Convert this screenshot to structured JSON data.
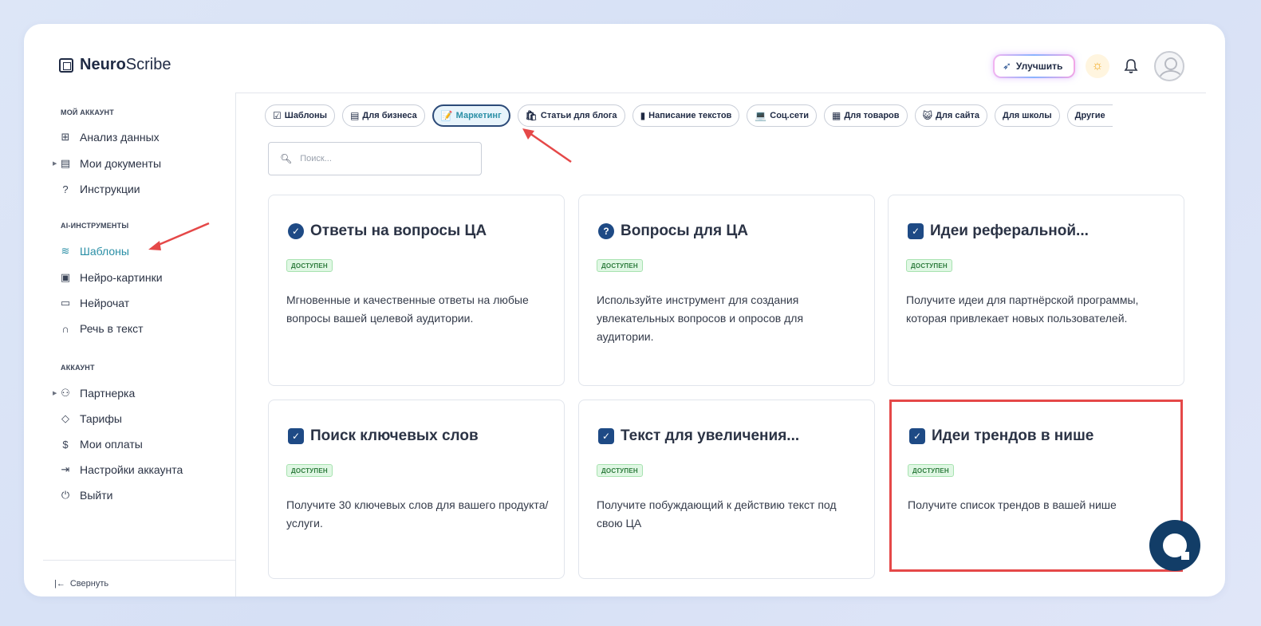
{
  "header": {
    "logo_bold": "Neuro",
    "logo_light": "Scribe",
    "upgrade_label": "Улучшить"
  },
  "sidebar": {
    "sections": [
      {
        "title": "МОЙ АККАУНТ"
      },
      {
        "title": "AI-ИНСТРУМЕНТЫ"
      },
      {
        "title": "АККАУНТ"
      }
    ],
    "items": [
      {
        "label": "Анализ данных",
        "icon": "grid-icon"
      },
      {
        "label": "Мои документы",
        "icon": "document-icon"
      },
      {
        "label": "Инструкции",
        "icon": "help-circle-icon"
      },
      {
        "label": "Шаблоны",
        "icon": "layers-icon"
      },
      {
        "label": "Нейро-картинки",
        "icon": "image-icon"
      },
      {
        "label": "Нейрочат",
        "icon": "chat-icon"
      },
      {
        "label": "Речь в текст",
        "icon": "headphones-icon"
      },
      {
        "label": "Партнерка",
        "icon": "users-icon"
      },
      {
        "label": "Тарифы",
        "icon": "tag-icon"
      },
      {
        "label": "Мои оплаты",
        "icon": "dollar-icon"
      },
      {
        "label": "Настройки аккаунта",
        "icon": "login-icon"
      },
      {
        "label": "Выйти",
        "icon": "power-icon"
      }
    ],
    "collapse_label": "Свернуть"
  },
  "categories": [
    {
      "emoji": "☑",
      "label": "Шаблоны"
    },
    {
      "emoji": "▤",
      "label": "Для бизнеса"
    },
    {
      "emoji": "📝",
      "label": "Маркетинг"
    },
    {
      "emoji": "🛍",
      "label": "Статьи для блога"
    },
    {
      "emoji": "▮",
      "label": "Написание текстов"
    },
    {
      "emoji": "💻",
      "label": "Соц.сети"
    },
    {
      "emoji": "▦",
      "label": "Для товаров"
    },
    {
      "emoji": "😺",
      "label": "Для сайта"
    },
    {
      "emoji": "",
      "label": "Для школы"
    },
    {
      "emoji": "",
      "label": "Другие"
    }
  ],
  "active_category": "Маркетинг",
  "search": {
    "placeholder": "Поиск..."
  },
  "cards": [
    {
      "title": "Ответы на вопросы ЦА",
      "badge": "ДОСТУПЕН",
      "description": "Мгновенные и качественные ответы на любые вопросы вашей целевой аудитории.",
      "icon": "check-circle-icon"
    },
    {
      "title": "Вопросы для ЦА",
      "badge": "ДОСТУПЕН",
      "description": "Используйте инструмент для создания увлекательных вопросов и опросов для аудитории.",
      "icon": "question-circle-icon"
    },
    {
      "title": "Идеи реферальной...",
      "badge": "ДОСТУПЕН",
      "description": "Получите идеи для партнёрской программы, которая привлекает новых пользователей.",
      "icon": "checkbox-icon"
    },
    {
      "title": "Поиск ключевых слов",
      "badge": "ДОСТУПЕН",
      "description": "Получите 30 ключевых слов для вашего продукта/услуги.",
      "icon": "checkbox-icon"
    },
    {
      "title": "Текст для увеличения...",
      "badge": "ДОСТУПЕН",
      "description": "Получите побуждающий к действию текст под свою ЦА",
      "icon": "checkbox-icon"
    },
    {
      "title": "Идеи трендов в нише",
      "badge": "ДОСТУПЕН",
      "description": "Получите список трендов в вашей нише",
      "icon": "checkbox-icon"
    }
  ],
  "colors": {
    "accent": "#2a8fa6",
    "brand_dark": "#1e4a85",
    "highlight": "#e54848",
    "badge_green": "#2f7d3e"
  }
}
